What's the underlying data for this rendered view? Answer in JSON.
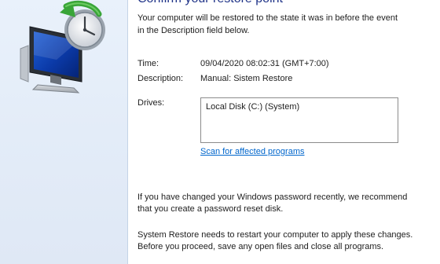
{
  "dialog": {
    "title": "Confirm your restore point",
    "intro_line1": "Your computer will be restored to the state it was in before the event",
    "intro_line2": "in the Description field below.",
    "time_label": "Time:",
    "time_value": "09/04/2020 08:02:31 (GMT+7:00)",
    "description_label": "Description:",
    "description_value": "Manual: Sistem Restore",
    "drives_label": "Drives:",
    "drives": [
      "Local Disk (C:) (System)"
    ],
    "scan_link": "Scan for affected programs",
    "password_note_line1": "If you have changed your Windows password recently, we recommend",
    "password_note_line2": "that you create a password reset disk.",
    "restart_note_line1": "System Restore needs to restart your computer to apply these changes.",
    "restart_note_line2": "Before you proceed, save any open files and close all programs."
  },
  "icons": {
    "graphic": "system-restore-icon"
  },
  "colors": {
    "title": "#1e3287",
    "link": "#0066cc",
    "sidebar": "#e3ecf8"
  }
}
